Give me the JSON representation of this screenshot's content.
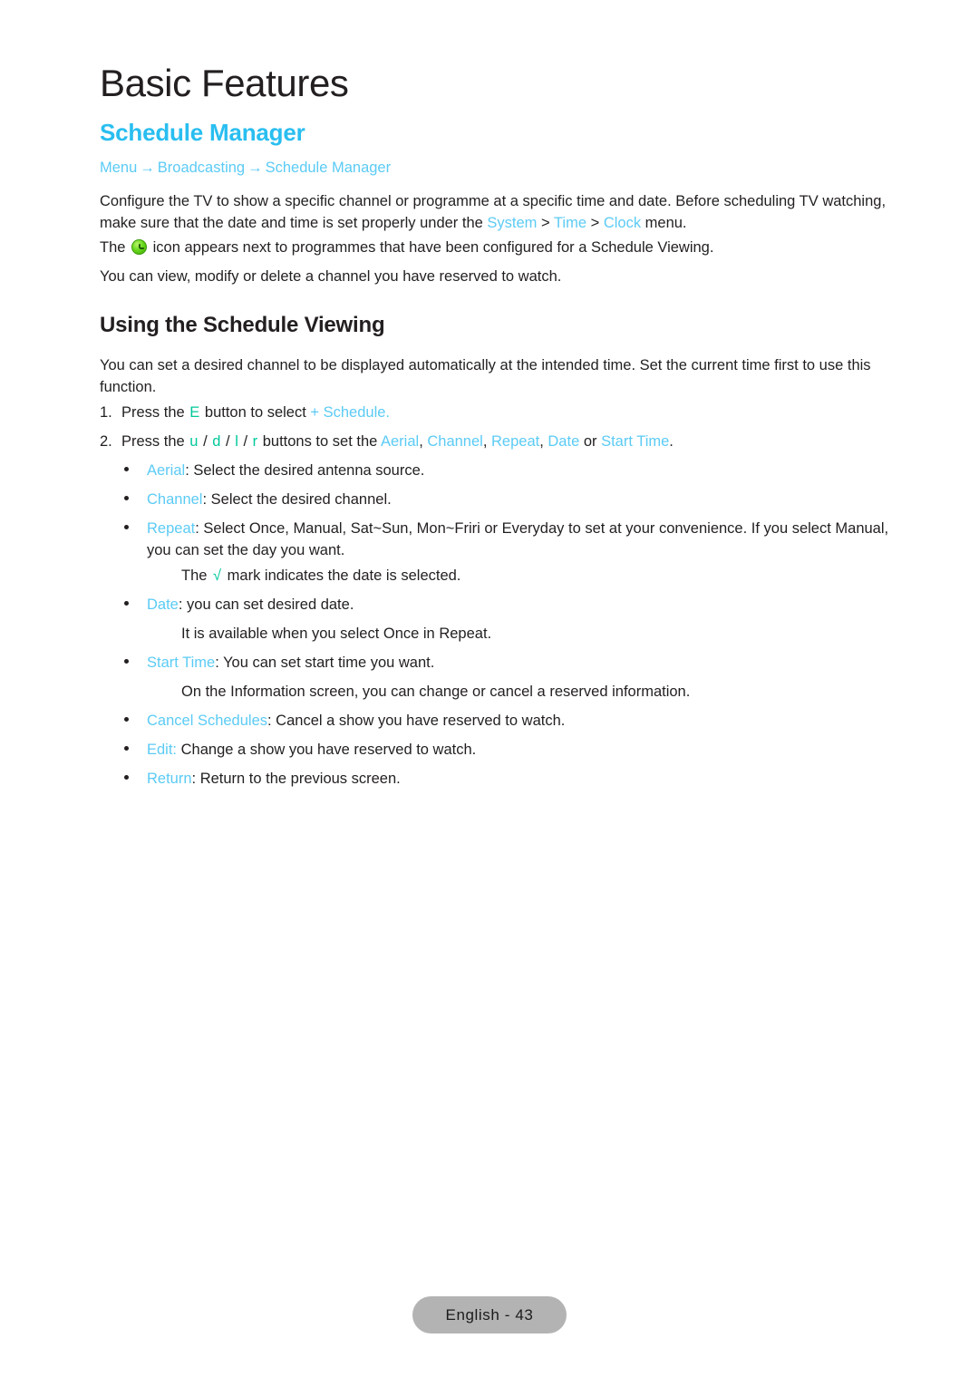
{
  "chapter": {
    "title": "Basic Features"
  },
  "section": {
    "heading": "Schedule Manager"
  },
  "breadcrumb": {
    "items": [
      "Menu",
      "Broadcasting",
      "Schedule Manager"
    ],
    "separator": "→"
  },
  "intro": {
    "para1_a": "Configure the TV to show a specific channel or programme at a specific time and date. Before scheduling TV watching, make sure that the date and time is set properly under the ",
    "para1_system": "System",
    "para1_sep1": " > ",
    "para1_time": "Time",
    "para1_sep2": " > ",
    "para1_clock": "Clock",
    "para1_b": " menu.",
    "para2_a": "The ",
    "para2_icon": "schedule-clock-icon",
    "para2_b": " icon appears next to programmes that have been configured for a Schedule Viewing.",
    "para3": "You can view, modify or delete a channel you have reserved to watch."
  },
  "subsection": {
    "heading": "Using the Schedule Viewing",
    "intro": "You can set a desired channel to be displayed automatically at the intended time. Set the current time first to use this function."
  },
  "steps": [
    {
      "num": "1.",
      "a": "Press the ",
      "key": "E",
      "b": "  button to select ",
      "target": "+ Schedule.",
      "c": ""
    },
    {
      "num": "2.",
      "a": "Press the ",
      "key_u": "u",
      "slash1": "  /  ",
      "key_d": "d",
      "slash2": "  /  ",
      "key_l": "l",
      "slash3": "  /  ",
      "key_r": "r",
      "b": "  buttons to set the ",
      "t1": "Aerial",
      "c1": ", ",
      "t2": "Channel",
      "c2": ", ",
      "t3": "Repeat",
      "c3": ", ",
      "t4": "Date",
      "c4": " or ",
      "t5": "Start Time",
      "c5": "."
    }
  ],
  "bullets": [
    {
      "term": "Aerial",
      "colon": ": ",
      "text": "Select the desired antenna source."
    },
    {
      "term": "Channel",
      "colon": ": ",
      "text": "Select the desired channel."
    },
    {
      "term": "Repeat",
      "colon": ": ",
      "text": "Select Once, Manual, Sat~Sun, Mon~Friri or Everyday to set at your convenience. If you select Manual, you can set the day you want."
    },
    {
      "term": "Date",
      "colon": ": ",
      "text": "you can set desired date."
    },
    {
      "term": "Start Time",
      "colon": ": ",
      "text": "You can set start time you want."
    },
    {
      "term": "Cancel Schedules",
      "colon": ": ",
      "text": "Cancel a show you have reserved to watch."
    },
    {
      "term": "Edit:",
      "colon": " ",
      "text": "Change a show you have reserved to watch."
    },
    {
      "term": "Return",
      "colon": ": ",
      "text": "Return to the previous screen."
    }
  ],
  "notes": {
    "check_a": "The ",
    "check_glyph": "√",
    "check_b": " mark indicates the date is selected.",
    "date_note": "It is available when you select Once in Repeat.",
    "info_note": "On the Information screen, you can change or cancel a reserved information."
  },
  "footer": {
    "label": "English - 43"
  },
  "colors": {
    "accent_cyan": "#5bcbf5",
    "heading_cyan": "#29bef0",
    "key_teal": "#00c89a",
    "text_dark": "#231f20",
    "footer_pill": "#b3b3b3"
  }
}
